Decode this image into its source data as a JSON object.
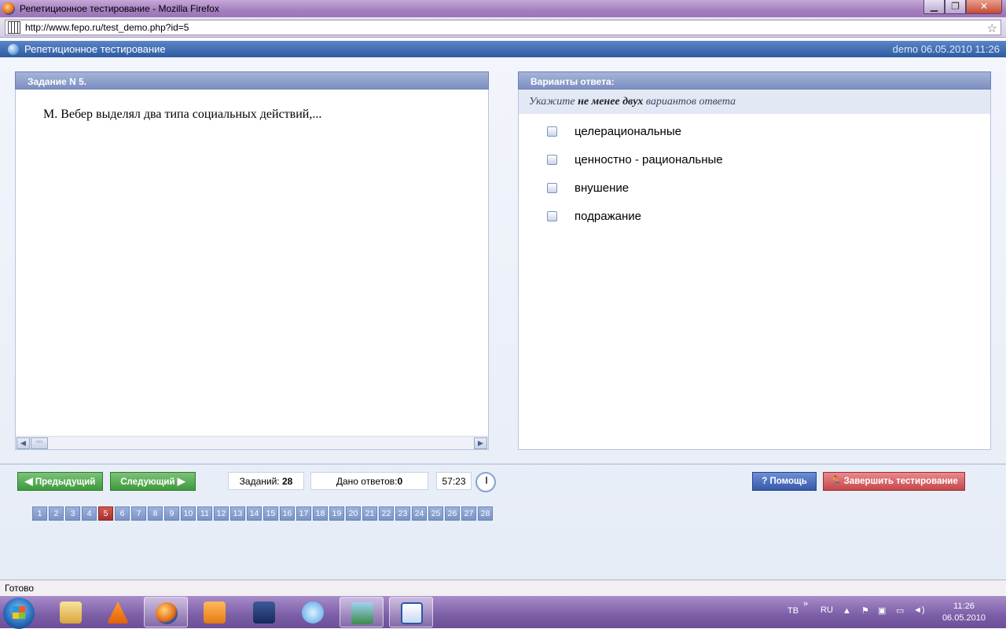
{
  "window": {
    "title": "Репетиционное тестирование - Mozilla Firefox",
    "minimize": "▁",
    "maximize": "❐",
    "close": "✕"
  },
  "browser": {
    "url": "http://www.fepo.ru/test_demo.php?id=5",
    "status": "Готово"
  },
  "app": {
    "title": "Репетиционное тестирование",
    "user_datetime": "demo 06.05.2010 11:26"
  },
  "task": {
    "header": "Задание N 5.",
    "question": "М. Вебер выделял два типа социальных действий,..."
  },
  "answers": {
    "header": "Варианты ответа:",
    "hint_prefix": "Укажите ",
    "hint_bold": "не менее двух",
    "hint_suffix": " вариантов ответа",
    "options": [
      "целерациональные",
      "ценностно - рациональные",
      "внушение",
      "подражание"
    ]
  },
  "controls": {
    "prev": "Предыдущий",
    "next": "Следующий",
    "tasks_label": "Заданий:",
    "tasks_count": "28",
    "answered_label": "Дано ответов:",
    "answered_count": "0",
    "timer": "57:23",
    "help": "Помощь",
    "finish": "Завершить тестирование"
  },
  "pager": {
    "pages": [
      "1",
      "2",
      "3",
      "4",
      "5",
      "6",
      "7",
      "8",
      "9",
      "10",
      "11",
      "12",
      "13",
      "14",
      "15",
      "16",
      "17",
      "18",
      "19",
      "20",
      "21",
      "22",
      "23",
      "24",
      "25",
      "26",
      "27",
      "28"
    ],
    "current": "5"
  },
  "taskbar": {
    "apps": [
      "file-explorer",
      "vlc",
      "firefox",
      "media-player",
      "floppy-save",
      "itunes",
      "photo-viewer",
      "word"
    ],
    "tray_lang1": "ТВ",
    "tray_lang2": "RU",
    "time": "11:26",
    "date": "06.05.2010"
  }
}
